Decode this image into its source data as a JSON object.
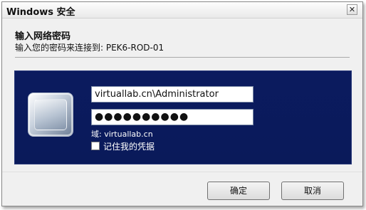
{
  "window": {
    "title": "Windows 安全",
    "close_glyph": "✕"
  },
  "header": {
    "title": "输入网络密码",
    "subtitle": "输入您的密码来连接到: PEK6-ROD-01"
  },
  "credentials": {
    "username_value": "virtuallab.cn\\Administrator",
    "password_mask": "●●●●●●●●●●",
    "domain_text": "域: virtuallab.cn",
    "remember_label": "记住我的凭据",
    "remember_checked": false,
    "avatar_icon": "user-tile-icon"
  },
  "footer": {
    "ok_label": "确定",
    "cancel_label": "取消"
  },
  "colors": {
    "panel_bg": "#0b1b5f",
    "dialog_bg": "#f0f0f0"
  }
}
